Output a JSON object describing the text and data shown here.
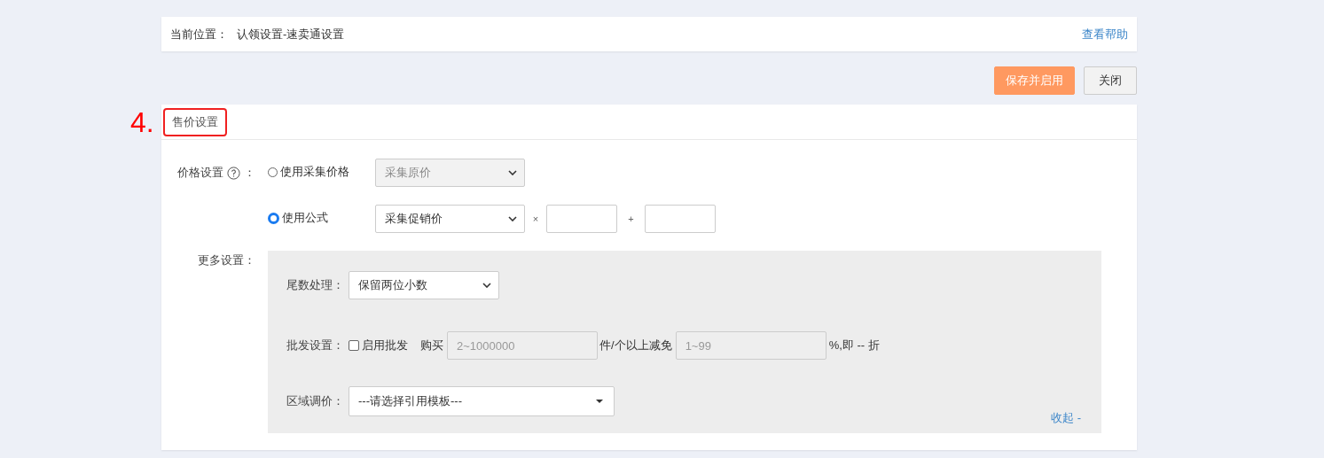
{
  "breadcrumb": {
    "label": "当前位置：",
    "path": "认领设置-速卖通设置",
    "help_link": "查看帮助"
  },
  "actions": [
    {
      "label": "保存并启用",
      "kind": "primary"
    },
    {
      "label": "关闭",
      "kind": "default"
    }
  ],
  "annotation": {
    "number": "4."
  },
  "section": {
    "title": "售价设置",
    "highlighted": true
  },
  "price_setting": {
    "label": "价格设置",
    "suffix": "：",
    "options": [
      {
        "label": "使用采集价格",
        "selected": false,
        "select_value": "采集原价",
        "disabled": true,
        "formula": false
      },
      {
        "label": "使用公式",
        "selected": true,
        "select_value": "采集促销价",
        "disabled": false,
        "formula": true
      }
    ],
    "times": "×",
    "plus": "+"
  },
  "more": {
    "label": "更多设置：",
    "rounding": {
      "label": "尾数处理：",
      "value": "保留两位小数"
    },
    "wholesale": {
      "label": "批发设置：",
      "checkbox": {
        "label": "启用批发",
        "checked": false
      },
      "buy": "购买",
      "qty_placeholder": "2~1000000",
      "unit_text": "件/个以上减免",
      "pct_placeholder": "1~99",
      "suffix": "%,即 -- 折"
    },
    "region": {
      "label": "区域调价：",
      "value": "---请选择引用模板---"
    },
    "collapse_link": "收起 -"
  }
}
